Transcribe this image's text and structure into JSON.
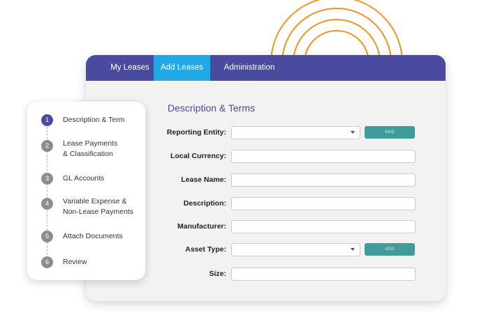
{
  "colors": {
    "nav_bg": "#4a4a9e",
    "nav_active": "#21a9e6",
    "accent": "#4a4a9e",
    "add_button": "#3f9c9a",
    "arcs": "#f0941f",
    "step_inactive": "#8c8c94"
  },
  "nav": {
    "tabs": [
      {
        "label": "My Leases",
        "active": false
      },
      {
        "label": "Add Leases",
        "active": true
      },
      {
        "label": "Administration",
        "active": false
      }
    ]
  },
  "form": {
    "title": "Description & Terms",
    "add_label": "ADD",
    "fields": [
      {
        "label": "Reporting Entity:",
        "type": "select",
        "value": "",
        "has_add": true
      },
      {
        "label": "Local Currency:",
        "type": "text",
        "value": ""
      },
      {
        "label": "Lease Name:",
        "type": "text",
        "value": ""
      },
      {
        "label": "Description:",
        "type": "text",
        "value": ""
      },
      {
        "label": "Manufacturer:",
        "type": "text",
        "value": ""
      },
      {
        "label": "Asset Type:",
        "type": "select",
        "value": "",
        "has_add": true
      },
      {
        "label": "Size:",
        "type": "text",
        "value": ""
      }
    ]
  },
  "steps": [
    {
      "num": "1",
      "label": "Description & Term",
      "active": true
    },
    {
      "num": "2",
      "label": "Lease Payments\n& Classification",
      "active": false
    },
    {
      "num": "3",
      "label": "GL Accounts",
      "active": false
    },
    {
      "num": "4",
      "label": "Variable Expense &\nNon-Lease Payments",
      "active": false
    },
    {
      "num": "5",
      "label": "Attach Documents",
      "active": false
    },
    {
      "num": "6",
      "label": "Review",
      "active": false
    }
  ]
}
